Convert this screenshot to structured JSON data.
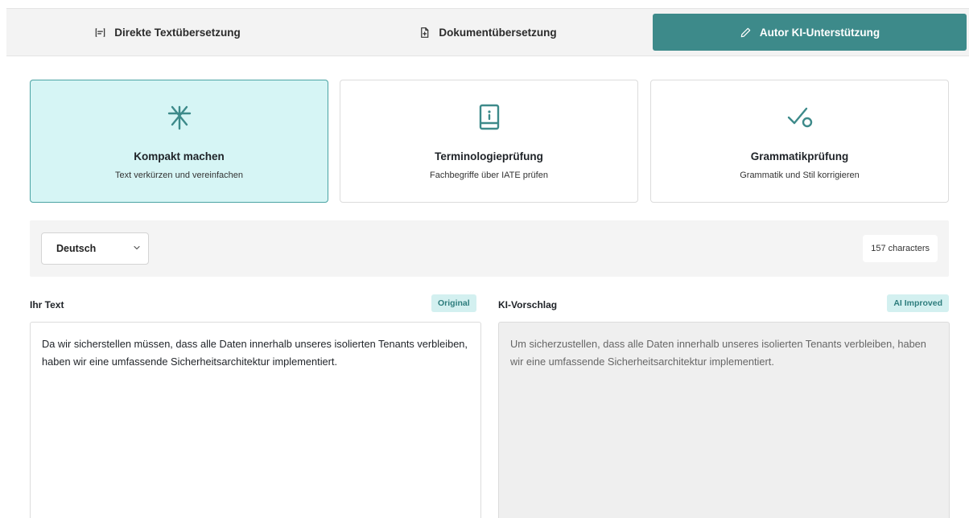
{
  "tabs": [
    {
      "label": "Direkte Textübersetzung",
      "icon": "text-lines-icon",
      "active": false
    },
    {
      "label": "Dokumentübersetzung",
      "icon": "document-plus-icon",
      "active": false
    },
    {
      "label": "Autor KI-Unterstützung",
      "icon": "pencil-icon",
      "active": true
    }
  ],
  "cards": [
    {
      "title": "Kompakt machen",
      "subtitle": "Text verkürzen und vereinfachen",
      "icon": "compress-asterisk-icon",
      "selected": true
    },
    {
      "title": "Terminologieprüfung",
      "subtitle": "Fachbegriffe über IATE prüfen",
      "icon": "book-info-icon",
      "selected": false
    },
    {
      "title": "Grammatikprüfung",
      "subtitle": "Grammatik und Stil korrigieren",
      "icon": "check-circle-icon",
      "selected": false
    }
  ],
  "toolbar": {
    "language": "Deutsch",
    "char_count": "157 characters"
  },
  "left_panel": {
    "label": "Ihr Text",
    "badge": "Original",
    "text": "Da wir sicherstellen müssen, dass alle Daten innerhalb unseres isolierten Tenants verbleiben, haben wir eine umfassende Sicherheitsarchitektur implementiert."
  },
  "right_panel": {
    "label": "KI-Vorschlag",
    "badge": "AI Improved",
    "text": "Um sicherzustellen, dass alle Daten innerhalb unseres isolierten Tenants verbleiben, haben wir eine umfassende Sicherheitsarchitektur implementiert."
  },
  "colors": {
    "accent": "#3d8a8a",
    "selected_card_bg": "#d6f5f5",
    "badge_bg": "#d3f0f0"
  }
}
